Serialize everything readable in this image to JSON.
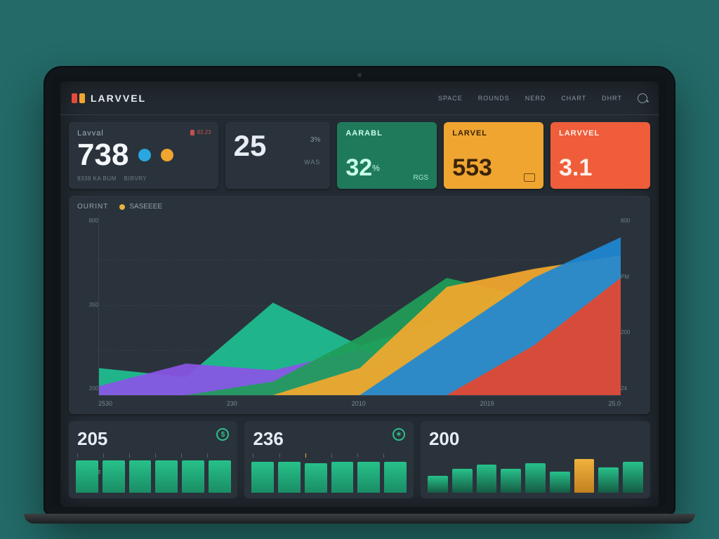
{
  "brand": {
    "name": "LARVVEL",
    "mark_colors": [
      "#e74a3a",
      "#f0a530"
    ]
  },
  "nav": {
    "items": [
      "SPACE",
      "ROUNDS",
      "NERD",
      "CHART",
      "DHRT"
    ]
  },
  "cards": {
    "c1": {
      "label": "Lavval",
      "value": "738",
      "dot_colors": [
        "#2aa7e0",
        "#f0a530"
      ],
      "footer1": "9338 KA BUM",
      "footer2": "BIRVRY",
      "badge": "83.23"
    },
    "c2": {
      "value": "25",
      "unit_top": "3%",
      "unit_bottom": "WAS"
    },
    "t_green": {
      "title": "AARABL",
      "value": "32",
      "unit": "%",
      "corner": "RGS"
    },
    "t_amber": {
      "title": "LARVEL",
      "value": "553"
    },
    "t_orange": {
      "title": "LARVVEL",
      "value": "3.1"
    }
  },
  "chart_head": {
    "title": "OURINT",
    "legend": "SASEEEE"
  },
  "chart_data": {
    "type": "area",
    "x": [
      "2530",
      "230",
      "2010",
      "2019",
      "25.0"
    ],
    "ylim_left": [
      0,
      800
    ],
    "yticks_left": [
      "800",
      "350",
      "200"
    ],
    "yticks_right": [
      "800",
      "PM",
      "200",
      "24"
    ],
    "series": [
      {
        "name": "teal",
        "color": "#1fbf92",
        "values": [
          120,
          80,
          410,
          220,
          340,
          150,
          90
        ]
      },
      {
        "name": "purple",
        "color": "#8a55e6",
        "values": [
          40,
          140,
          110,
          200,
          80,
          60,
          30
        ]
      },
      {
        "name": "green2",
        "color": "#1f9d58",
        "values": [
          0,
          0,
          60,
          260,
          520,
          430,
          380
        ]
      },
      {
        "name": "amber",
        "color": "#f4a82e",
        "values": [
          0,
          0,
          0,
          120,
          480,
          560,
          620
        ]
      },
      {
        "name": "blue",
        "color": "#1e88d4",
        "values": [
          0,
          0,
          0,
          0,
          260,
          520,
          700
        ]
      },
      {
        "name": "red",
        "color": "#e6452f",
        "values": [
          0,
          0,
          0,
          0,
          0,
          220,
          520
        ]
      }
    ]
  },
  "bottom": {
    "b1": {
      "value": "205",
      "bars": [
        46,
        46,
        46,
        46,
        46,
        46
      ],
      "sublabel": "RASENE"
    },
    "b2": {
      "value": "236",
      "bars": [
        44,
        44,
        42,
        44,
        44,
        44
      ]
    },
    "b3": {
      "value": "200",
      "bars": [
        24,
        34,
        40,
        34,
        42,
        30,
        48,
        36,
        44
      ]
    }
  }
}
